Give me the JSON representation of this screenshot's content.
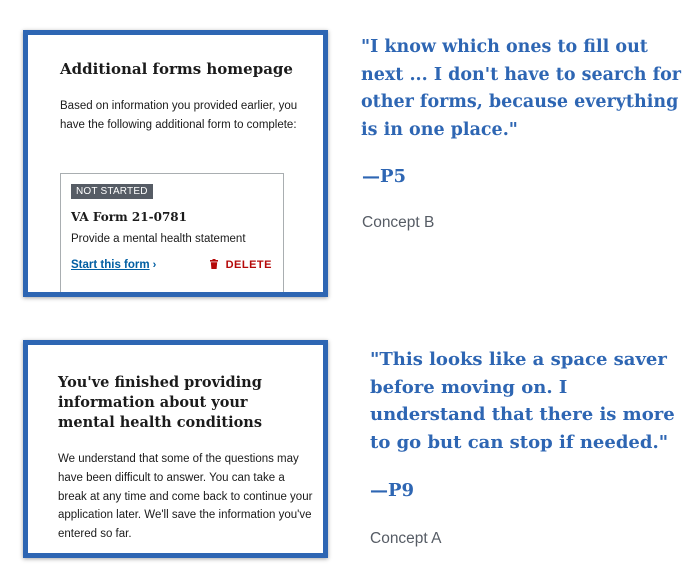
{
  "cards": [
    {
      "title": "Additional forms homepage",
      "body": "Based on information you provided earlier, you have the following additional form to complete:",
      "form": {
        "status_badge": "NOT STARTED",
        "name": "VA Form 21-0781",
        "description": "Provide a mental health statement",
        "start_link": "Start this form",
        "start_chevron": "›",
        "delete_label": "DELETE"
      }
    },
    {
      "title": "You've finished providing information about your mental health conditions",
      "body": "We understand that some of the questions may have been difficult to answer. You can take a break at any time and come back to continue your application later. We'll save the information you've entered so far."
    }
  ],
  "quotes": [
    {
      "text": "\"I know which ones to fill out next ... I don't have to search for other forms, because everything is in one place.\"",
      "participant": "—P5",
      "concept": "Concept B"
    },
    {
      "text": "\"This looks like a space saver before moving on. I understand that there is more to go but can stop if needed.\"",
      "participant": "—P9",
      "concept": "Concept A"
    }
  ],
  "colors": {
    "accent_blue": "#2e66b3",
    "link_blue": "#005ea2",
    "delete_red": "#b50909",
    "badge_gray": "#565c65"
  },
  "icons": {
    "delete": "trash-icon",
    "start": "chevron-right-icon"
  }
}
